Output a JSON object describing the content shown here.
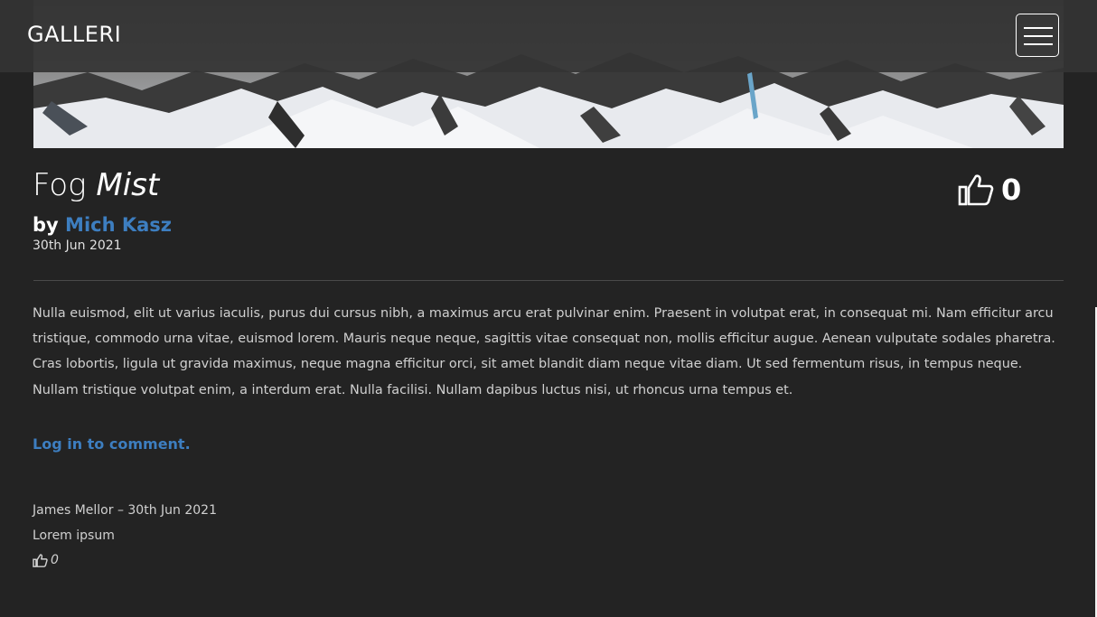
{
  "navbar": {
    "brand": "GALLERI"
  },
  "photo": {
    "title_main": "Fog",
    "title_em": "Mist",
    "by_label": "by",
    "author": "Mich Kasz",
    "date": "30th Jun 2021",
    "like_count": "0",
    "description": "Nulla euismod, elit ut varius iaculis, purus dui cursus nibh, a maximus arcu erat pulvinar enim. Praesent in volutpat erat, in consequat mi. Nam efficitur arcu tristique, commodo urna vitae, euismod lorem. Mauris neque neque, sagittis vitae consequat non, mollis efficitur augue. Aenean vulputate sodales pharetra. Cras lobortis, ligula ut gravida maximus, neque magna efficitur orci, sit amet blandit diam neque vitae diam. Ut sed fermentum risus, in tempus neque. Nullam tristique volutpat enim, a interdum erat. Nulla facilisi. Nullam dapibus luctus nisi, ut rhoncus urna tempus et."
  },
  "comments_section": {
    "login_prompt": "Log in to comment.",
    "comments": [
      {
        "meta": "James Mellor – 30th Jun 2021",
        "body": "Lorem ipsum",
        "like_count": "0"
      }
    ]
  },
  "colors": {
    "background": "#232323",
    "navbar": "#343434",
    "link": "#3d7ec0",
    "text": "#d0d0d0"
  },
  "icons": {
    "menu": "hamburger-icon",
    "like": "thumbs-up-icon"
  }
}
